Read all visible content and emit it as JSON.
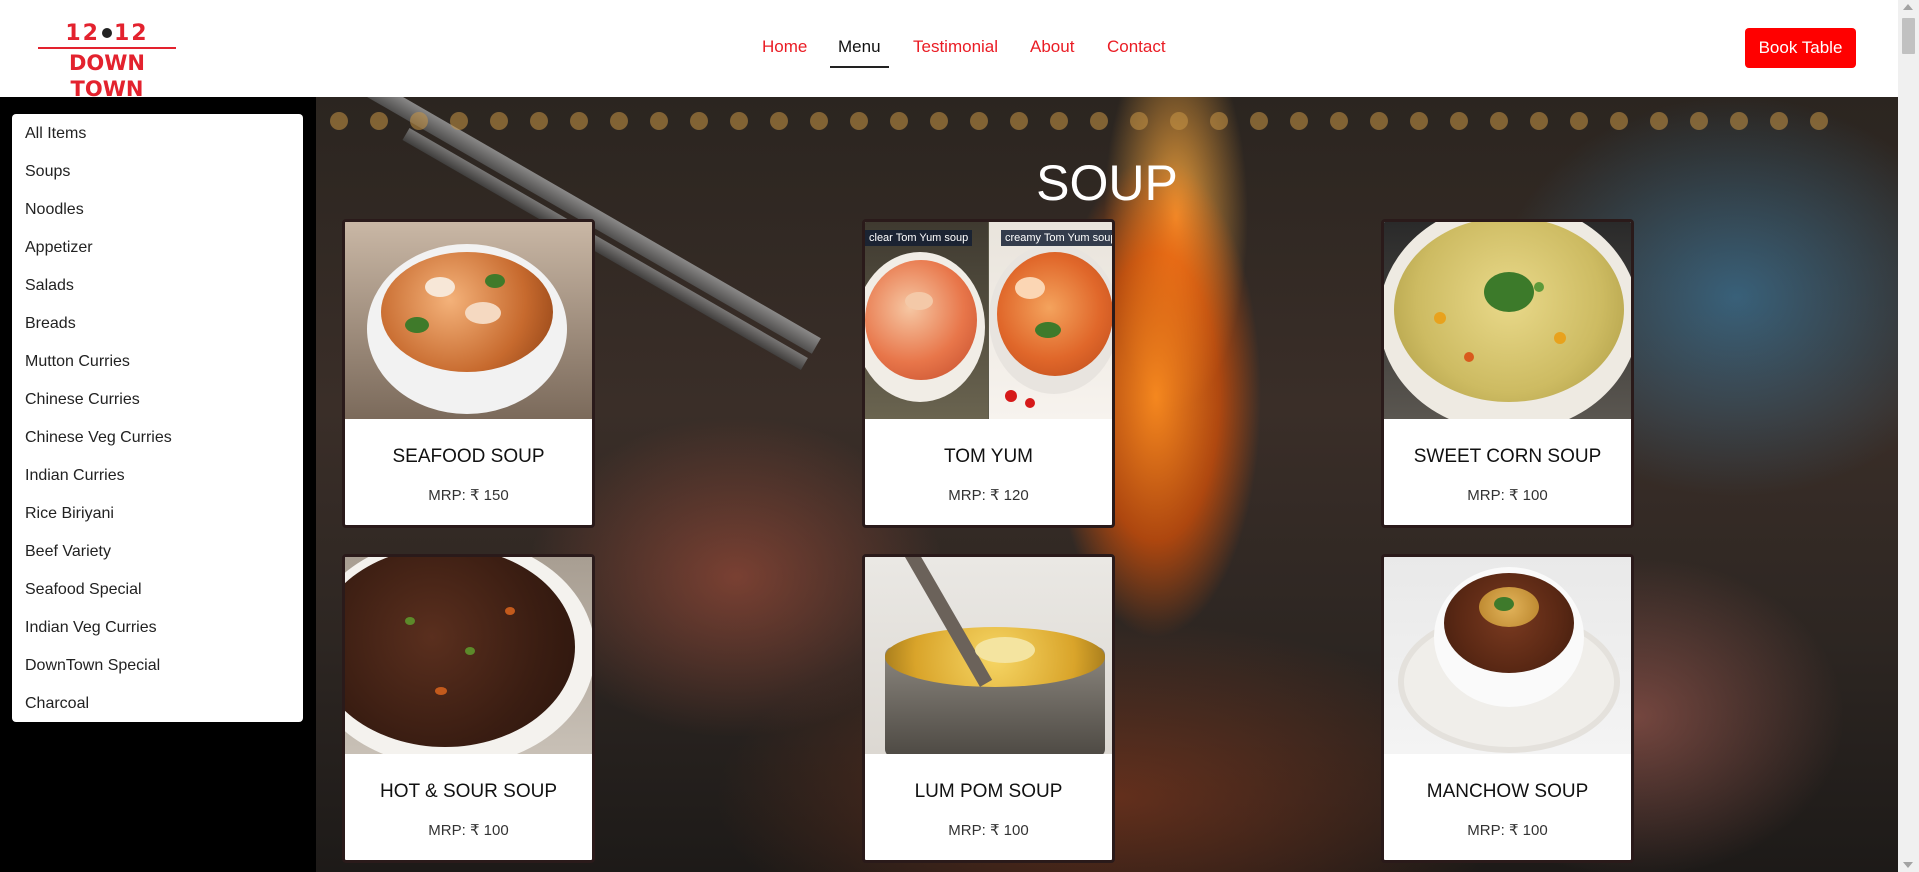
{
  "header": {
    "logo_top_left": "12",
    "logo_top_right": "12",
    "logo_bottom": "DOWN TOWN",
    "nav": [
      {
        "label": "Home"
      },
      {
        "label": "Menu"
      },
      {
        "label": "Testimonial"
      },
      {
        "label": "About"
      },
      {
        "label": "Contact"
      }
    ],
    "active_nav": "Menu",
    "book_button": "Book Table",
    "accent_color": "#ea1c24"
  },
  "sidebar": {
    "items": [
      "All Items",
      "Soups",
      "Noodles",
      "Appetizer",
      "Salads",
      "Breads",
      "Mutton Curries",
      "Chinese Curries",
      "Chinese Veg Curries",
      "Indian Curries",
      "Rice Biriyani",
      "Beef Variety",
      "Seafood Special",
      "Indian Veg Curries",
      "DownTown Special",
      "Charcoal"
    ]
  },
  "main": {
    "section_title": "SOUP",
    "cards": [
      {
        "name": "SEAFOOD SOUP",
        "price": "MRP: ₹ 150",
        "image": "seafood-soup-bowl"
      },
      {
        "name": "TOM YUM",
        "price": "MRP: ₹ 120",
        "image": "tom-yum-split",
        "image_labels": [
          "clear Tom Yum soup",
          "creamy Tom Yum soup"
        ]
      },
      {
        "name": "SWEET CORN SOUP",
        "price": "MRP: ₹ 100",
        "image": "sweet-corn-soup-bowl"
      },
      {
        "name": "HOT & SOUR SOUP",
        "price": "MRP: ₹ 100",
        "image": "hot-sour-soup-bowl"
      },
      {
        "name": "LUM POM SOUP",
        "price": "MRP: ₹ 100",
        "image": "lum-pom-soup-pot"
      },
      {
        "name": "MANCHOW SOUP",
        "price": "MRP: ₹ 100",
        "image": "manchow-soup-bowl"
      }
    ]
  }
}
